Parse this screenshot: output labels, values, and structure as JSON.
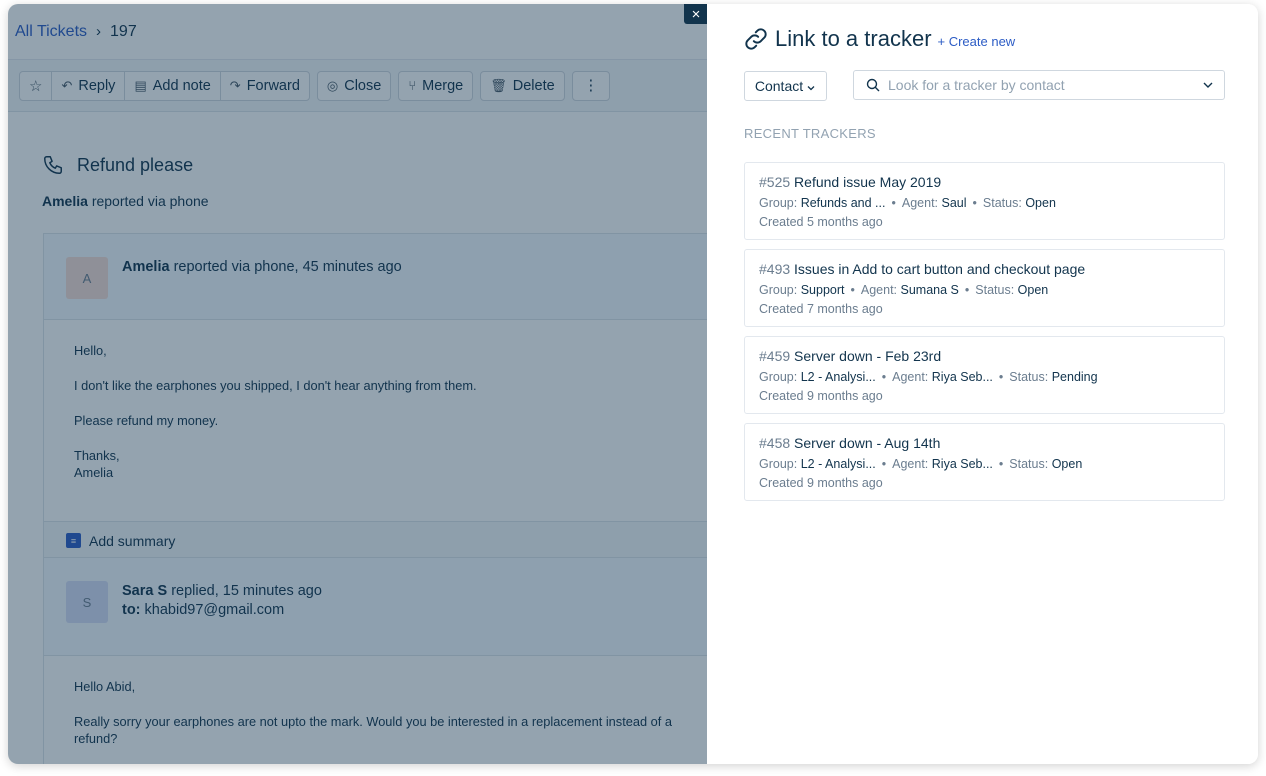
{
  "breadcrumb": {
    "root": "All Tickets",
    "sep": "›",
    "current": "197"
  },
  "toolbar": {
    "star": "☆",
    "reply": "Reply",
    "add_note": "Add note",
    "forward": "Forward",
    "close": "Close",
    "merge": "Merge",
    "delete": "Delete",
    "more": "⋮"
  },
  "ticket": {
    "subject": "Refund please",
    "requester": "Amelia",
    "reported_via": "reported via phone"
  },
  "conversations": [
    {
      "avatar": "A",
      "author": "Amelia",
      "meta": "reported via phone, 45 minutes ago",
      "to": "",
      "body": [
        "Hello,",
        "I don't like the earphones you shipped, I don't hear anything from them.",
        "Please refund my money.",
        "Thanks,\nAmelia"
      ]
    },
    {
      "avatar": "S",
      "author": "Sara S",
      "meta": "replied, 15 minutes ago",
      "to_label": "to:",
      "to": "khabid97@gmail.com",
      "body": [
        "Hello Abid,",
        "Really sorry your earphones are not upto the mark. Would you be interested in a replacement instead of a refund?"
      ]
    }
  ],
  "summary": {
    "label": "Add summary"
  },
  "close_icon": "×",
  "panel": {
    "title": "Link to a tracker",
    "create_new": "+ Create new",
    "contact_label": "Contact",
    "search_placeholder": "Look for a tracker by contact",
    "recent_label": "RECENT TRACKERS",
    "trackers": [
      {
        "num": "#525",
        "title": "Refund issue May 2019",
        "group": "Refunds and ...",
        "agent": "Saul",
        "status": "Open",
        "created": "Created 5 months ago"
      },
      {
        "num": "#493",
        "title": "Issues in Add to cart button and checkout page",
        "group": "Support",
        "agent": "Sumana S",
        "status": "Open",
        "created": "Created 7 months ago"
      },
      {
        "num": "#459",
        "title": "Server down - Feb 23rd",
        "group": "L2 - Analysi...",
        "agent": "Riya Seb...",
        "status": "Pending",
        "created": "Created 9 months ago"
      },
      {
        "num": "#458",
        "title": "Server down - Aug 14th",
        "group": "L2 - Analysi...",
        "agent": "Riya Seb...",
        "status": "Open",
        "created": "Created 9 months ago"
      }
    ],
    "labels": {
      "group": "Group:",
      "agent": "Agent:",
      "status": "Status:"
    }
  },
  "colors": {
    "accent": "#2c5cc5",
    "text": "#12344d",
    "muted": "#6b7d8f",
    "overlay": "#12344d"
  }
}
